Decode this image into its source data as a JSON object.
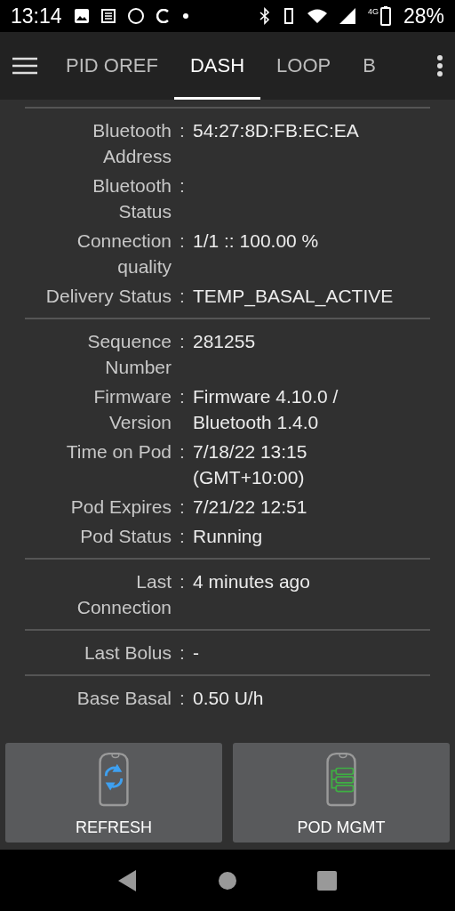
{
  "status_bar": {
    "time": "13:14",
    "battery": "28%",
    "network": "4G"
  },
  "tabs": [
    {
      "label": "PID OREF",
      "selected": false
    },
    {
      "label": "DASH",
      "selected": true
    },
    {
      "label": "LOOP",
      "selected": false
    },
    {
      "label": "B",
      "selected": false
    }
  ],
  "sections": [
    [
      {
        "label": [
          "Bluetooth",
          "Address"
        ],
        "separator": ":",
        "value": [
          "54:27:8D:FB:EC:EA"
        ]
      },
      {
        "label": [
          "Bluetooth",
          "Status"
        ],
        "separator": ":"
      },
      {
        "label": [
          "Connection",
          "quality"
        ],
        "separator": ":",
        "value": [
          "1/1 :: 100.00 %"
        ]
      },
      {
        "label": [
          "Delivery Status"
        ],
        "separator": ":",
        "value": [
          "TEMP_BASAL_ACTIVE"
        ]
      }
    ],
    [
      {
        "label": [
          "Sequence",
          "Number"
        ],
        "separator": ":",
        "value": [
          "281255"
        ]
      },
      {
        "label": [
          "Firmware",
          "Version"
        ],
        "separator": ":",
        "value": [
          "Firmware 4.10.0 /",
          "Bluetooth 1.4.0"
        ]
      },
      {
        "label": [
          "Time on Pod"
        ],
        "separator": ":",
        "value": [
          "7/18/22 13:15",
          "(GMT+10:00)"
        ]
      },
      {
        "label": [
          "Pod Expires"
        ],
        "separator": ":",
        "value": [
          "7/21/22 12:51"
        ]
      },
      {
        "label": [
          "Pod Status"
        ],
        "separator": ":",
        "value": [
          "Running"
        ]
      }
    ],
    [
      {
        "label": [
          "Last",
          "Connection"
        ],
        "separator": ":",
        "value": [
          "4 minutes ago"
        ]
      }
    ],
    [
      {
        "label": [
          "Last Bolus"
        ],
        "separator": ":",
        "value": [
          "-"
        ]
      }
    ],
    [
      {
        "label": [
          "Base Basal"
        ],
        "separator": ":",
        "value": [
          "0.50 U/h"
        ]
      }
    ]
  ],
  "buttons": [
    {
      "label": "REFRESH",
      "kind": "refresh"
    },
    {
      "label": "POD MGMT",
      "kind": "manage"
    }
  ]
}
